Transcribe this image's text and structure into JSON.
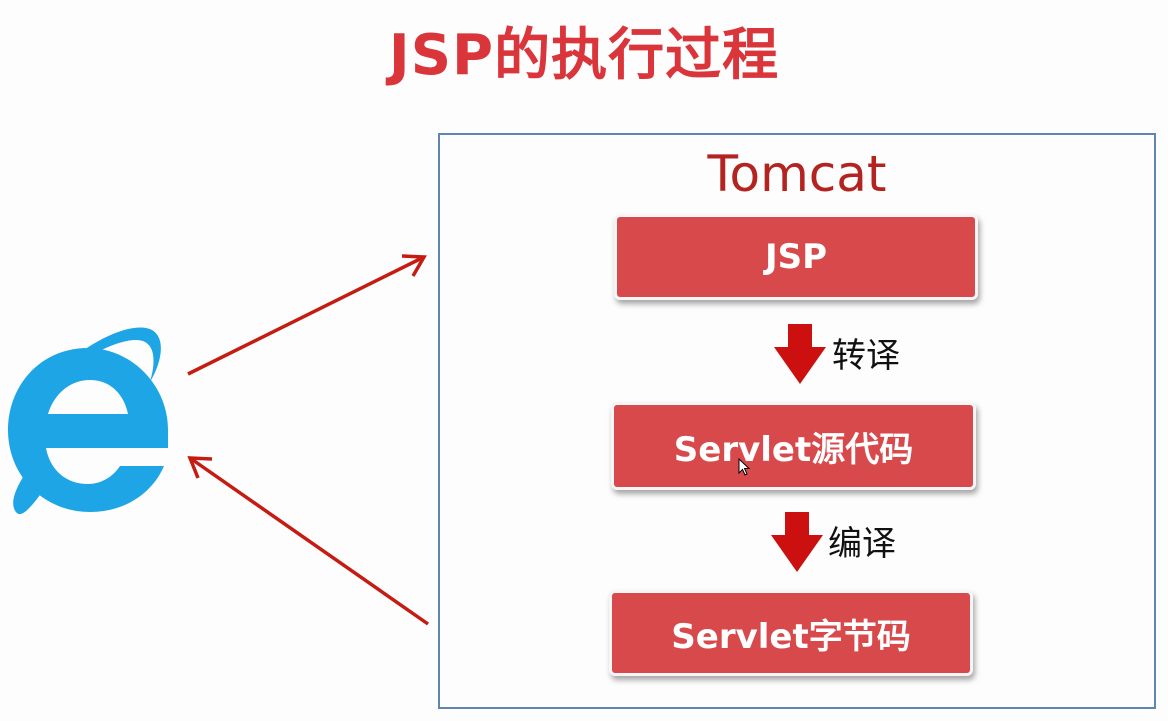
{
  "title": "JSP的执行过程",
  "container": {
    "label": "Tomcat"
  },
  "stages": [
    {
      "label": "JSP"
    },
    {
      "label": "Servlet源代码"
    },
    {
      "label": "Servlet字节码"
    }
  ],
  "steps": [
    {
      "label": "转译"
    },
    {
      "label": "编译"
    }
  ],
  "icons": {
    "browser": "internet-explorer-icon",
    "cursor": "mouse-pointer-icon"
  },
  "colors": {
    "title": "#d9353a",
    "tomcat_label": "#b3231f",
    "stage_fill": "#d8494c",
    "arrow": "#c41c12",
    "down_arrow": "#cc1010",
    "browser_blue": "#1ea5e6",
    "container_border": "#5f86b3"
  }
}
